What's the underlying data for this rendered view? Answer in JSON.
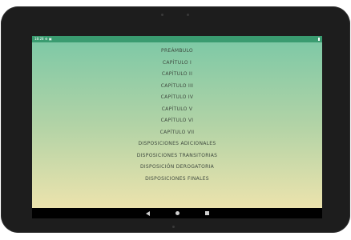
{
  "status": {
    "time": "18:28",
    "icons": "⚙ ▣"
  },
  "menu": {
    "items": [
      {
        "label": "PREÁMBULO"
      },
      {
        "label": "CAPÍTULO I"
      },
      {
        "label": "CAPÍTULO II"
      },
      {
        "label": "CAPÍTULO III"
      },
      {
        "label": "CAPÍTULO IV"
      },
      {
        "label": "CAPÍTULO V"
      },
      {
        "label": "CAPÍTULO VI"
      },
      {
        "label": "CAPÍTULO VII"
      },
      {
        "label": "DISPOSICIONES ADICIONALES"
      },
      {
        "label": "DISPOSICIONES TRANSITORIAS"
      },
      {
        "label": "DISPOSICIÓN DEROGATORIA"
      },
      {
        "label": "DISPOSICIONES FINALES"
      }
    ]
  },
  "colors": {
    "statusbar": "#3a9b70",
    "gradient_top": "#7fc9a6",
    "gradient_bottom": "#ece3ad",
    "menu_text": "#3f4a3f"
  }
}
